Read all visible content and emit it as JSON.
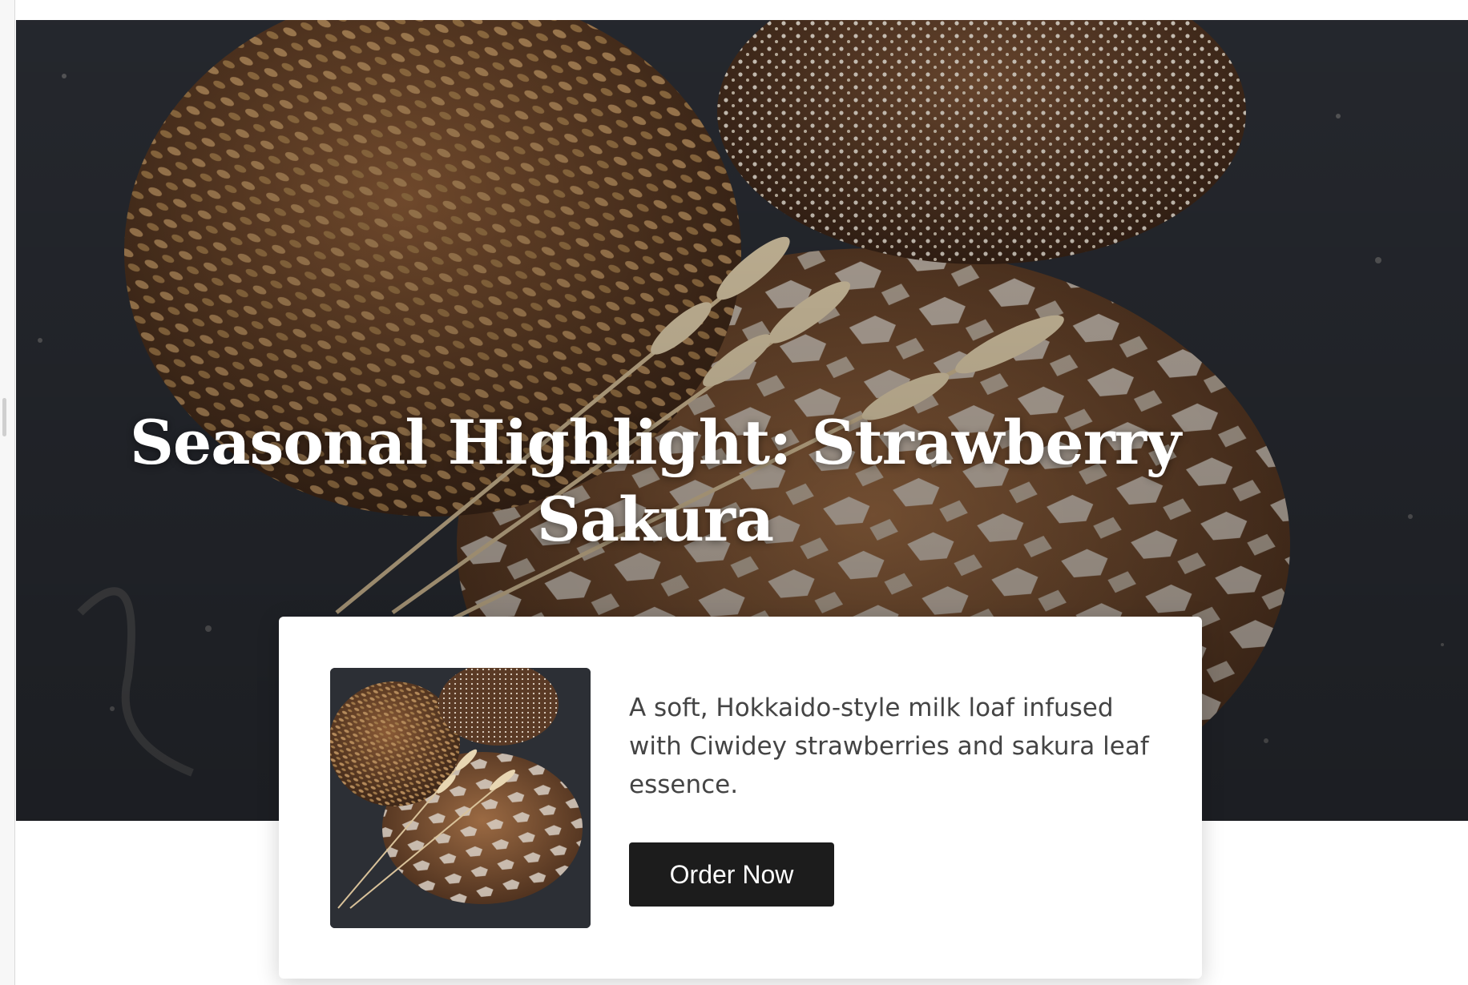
{
  "hero": {
    "image": "bread-loaves-with-wheat-photo",
    "title": "Seasonal Highlight: Strawberry Sakura"
  },
  "product_card": {
    "image": "bread-loaves-thumbnail",
    "description": "A soft, Hokkaido-style milk loaf infused with Ciwidey strawberries and sakura leaf essence.",
    "order_button_label": "Order Now"
  },
  "colors": {
    "button_background": "#1c1c1c",
    "button_text": "#ffffff",
    "description_text": "#444444",
    "card_background": "#ffffff"
  }
}
